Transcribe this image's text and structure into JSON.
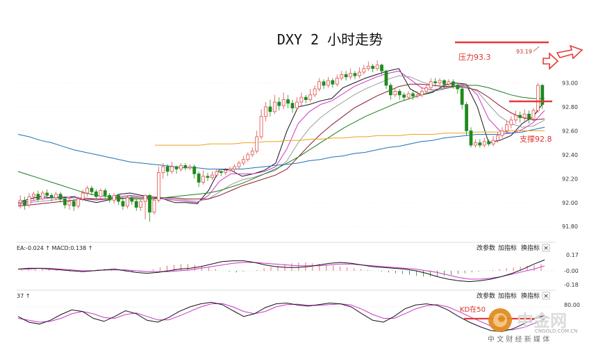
{
  "header": {
    "title": "DXY 2 小时走势"
  },
  "annotations": {
    "resistance_label": "压力93.3",
    "support_label": "支撑92.8",
    "current_high_label": "93.19",
    "kd_note": "KD在50"
  },
  "macd_panel": {
    "indicator_label": "EA:-0.024 ↑ MACD:0.138 ↑",
    "buttons": [
      "改参数",
      "加指标",
      "换指标",
      "×"
    ],
    "y_ticks": [
      "0.17",
      "-0.00",
      "-0.18"
    ]
  },
  "kd_panel": {
    "indicator_label": "37 ↑",
    "buttons": [
      "改参数",
      "加指标",
      "换指标",
      "×"
    ],
    "y_ticks": [
      "80.00"
    ]
  },
  "watermark": {
    "logo_text": "中金网",
    "domain": "CNGOLD.COM.CN",
    "tagline": "中 文 财 经 新 媒 体"
  },
  "chart_data": {
    "type": "line",
    "title": "DXY 2 小时走势",
    "y_ticks": [
      91.8,
      92.0,
      92.2,
      92.4,
      92.6,
      92.8,
      93.0
    ],
    "ylim": [
      91.72,
      93.2
    ],
    "levels": {
      "resistance": 93.3,
      "support": 92.8,
      "high": 93.19
    },
    "candles": [
      [
        92.0,
        92.02,
        92.06,
        91.95
      ],
      [
        92.02,
        91.98,
        92.05,
        91.94
      ],
      [
        91.98,
        92.05,
        92.08,
        91.96
      ],
      [
        92.05,
        92.07,
        92.09,
        92.02
      ],
      [
        92.07,
        92.03,
        92.1,
        92.01
      ],
      [
        92.03,
        92.08,
        92.1,
        92.02
      ],
      [
        92.08,
        92.06,
        92.11,
        92.04
      ],
      [
        92.06,
        92.04,
        92.08,
        92.01
      ],
      [
        92.04,
        92.07,
        92.09,
        92.02
      ],
      [
        92.07,
        92.03,
        92.09,
        92.0
      ],
      [
        92.03,
        91.98,
        92.05,
        91.95
      ],
      [
        91.98,
        92.01,
        92.04,
        91.94
      ],
      [
        92.01,
        91.97,
        92.03,
        91.93
      ],
      [
        91.97,
        92.03,
        92.05,
        91.95
      ],
      [
        92.03,
        92.08,
        92.11,
        92.01
      ],
      [
        92.08,
        92.12,
        92.14,
        92.05
      ],
      [
        92.12,
        92.09,
        92.14,
        92.06
      ],
      [
        92.09,
        92.05,
        92.11,
        92.03
      ],
      [
        92.05,
        92.1,
        92.12,
        92.03
      ],
      [
        92.1,
        92.06,
        92.12,
        92.03
      ],
      [
        92.06,
        92.02,
        92.08,
        92.0
      ],
      [
        92.02,
        92.06,
        92.08,
        91.99
      ],
      [
        92.06,
        92.01,
        92.07,
        91.98
      ],
      [
        92.01,
        91.97,
        92.04,
        91.94
      ],
      [
        91.97,
        92.04,
        92.06,
        91.95
      ],
      [
        92.04,
        92.01,
        92.06,
        91.98
      ],
      [
        92.01,
        91.96,
        92.03,
        91.93
      ],
      [
        91.96,
        92.01,
        92.03,
        91.93
      ],
      [
        92.01,
        92.06,
        92.07,
        91.86
      ],
      [
        92.06,
        91.92,
        92.07,
        91.84
      ],
      [
        91.92,
        92.02,
        92.05,
        91.9
      ],
      [
        92.02,
        92.25,
        92.3,
        92.0
      ],
      [
        92.25,
        92.3,
        92.33,
        92.2
      ],
      [
        92.3,
        92.26,
        92.32,
        92.22
      ],
      [
        92.26,
        92.3,
        92.34,
        92.24
      ],
      [
        92.3,
        92.28,
        92.31,
        92.24
      ],
      [
        92.28,
        92.31,
        92.33,
        92.26
      ],
      [
        92.31,
        92.29,
        92.33,
        92.27
      ],
      [
        92.29,
        92.3,
        92.32,
        92.27
      ],
      [
        92.3,
        92.24,
        92.32,
        92.2
      ],
      [
        92.24,
        92.17,
        92.26,
        92.13
      ],
      [
        92.17,
        92.22,
        92.27,
        92.15
      ],
      [
        92.22,
        92.21,
        92.25,
        92.18
      ],
      [
        92.21,
        92.23,
        92.26,
        92.19
      ],
      [
        92.23,
        92.26,
        92.28,
        92.21
      ],
      [
        92.26,
        92.25,
        92.28,
        92.22
      ],
      [
        92.25,
        92.27,
        92.29,
        92.23
      ],
      [
        92.27,
        92.28,
        92.3,
        92.25
      ],
      [
        92.28,
        92.3,
        92.32,
        92.26
      ],
      [
        92.3,
        92.33,
        92.35,
        92.28
      ],
      [
        92.33,
        92.36,
        92.39,
        92.31
      ],
      [
        92.36,
        92.4,
        92.42,
        92.34
      ],
      [
        92.4,
        92.43,
        92.46,
        92.38
      ],
      [
        92.43,
        92.55,
        92.6,
        92.41
      ],
      [
        92.55,
        92.72,
        92.78,
        92.53
      ],
      [
        92.72,
        92.8,
        92.84,
        92.68
      ],
      [
        92.8,
        92.76,
        92.86,
        92.72
      ],
      [
        92.76,
        92.84,
        92.9,
        92.74
      ],
      [
        92.84,
        92.81,
        92.88,
        92.77
      ],
      [
        92.81,
        92.86,
        92.92,
        92.78
      ],
      [
        92.86,
        92.83,
        92.9,
        92.79
      ],
      [
        92.83,
        92.79,
        92.86,
        92.75
      ],
      [
        92.79,
        92.84,
        92.88,
        92.77
      ],
      [
        92.84,
        92.88,
        92.92,
        92.81
      ],
      [
        92.88,
        92.86,
        92.9,
        92.83
      ],
      [
        92.86,
        92.9,
        92.95,
        92.84
      ],
      [
        92.9,
        92.95,
        92.98,
        92.88
      ],
      [
        92.95,
        93.01,
        93.04,
        92.93
      ],
      [
        93.01,
        92.98,
        93.03,
        92.95
      ],
      [
        92.98,
        93.02,
        93.05,
        92.96
      ],
      [
        93.02,
        92.99,
        93.04,
        92.96
      ],
      [
        92.99,
        93.04,
        93.07,
        92.97
      ],
      [
        93.04,
        93.07,
        93.1,
        93.02
      ],
      [
        93.07,
        93.05,
        93.1,
        93.02
      ],
      [
        93.05,
        93.08,
        93.12,
        93.03
      ],
      [
        93.08,
        93.06,
        93.1,
        93.03
      ],
      [
        93.06,
        93.09,
        93.13,
        93.04
      ],
      [
        93.09,
        93.12,
        93.15,
        93.07
      ],
      [
        93.12,
        93.14,
        93.18,
        93.1
      ],
      [
        93.14,
        93.12,
        93.16,
        93.09
      ],
      [
        93.12,
        93.15,
        93.19,
        93.1
      ],
      [
        93.15,
        93.1,
        93.16,
        93.07
      ],
      [
        93.1,
        92.98,
        93.11,
        92.95
      ],
      [
        92.98,
        92.9,
        93.0,
        92.86
      ],
      [
        92.9,
        92.93,
        92.96,
        92.88
      ],
      [
        92.93,
        92.9,
        92.95,
        92.86
      ],
      [
        92.9,
        92.88,
        92.92,
        92.85
      ],
      [
        92.88,
        92.91,
        92.93,
        92.86
      ],
      [
        92.91,
        92.89,
        92.93,
        92.86
      ],
      [
        92.89,
        92.9,
        92.93,
        92.87
      ],
      [
        92.9,
        92.93,
        92.96,
        92.88
      ],
      [
        92.93,
        92.96,
        92.99,
        92.91
      ],
      [
        92.96,
        93.01,
        93.04,
        92.94
      ],
      [
        93.01,
        93.0,
        93.04,
        92.97
      ],
      [
        93.0,
        93.02,
        93.04,
        92.98
      ],
      [
        93.02,
        92.99,
        93.03,
        92.96
      ],
      [
        92.99,
        93.01,
        93.03,
        92.97
      ],
      [
        93.01,
        92.98,
        93.03,
        92.95
      ],
      [
        92.98,
        92.95,
        93.0,
        92.91
      ],
      [
        92.95,
        92.82,
        92.96,
        92.78
      ],
      [
        92.82,
        92.6,
        92.84,
        92.56
      ],
      [
        92.6,
        92.48,
        92.63,
        92.46
      ],
      [
        92.48,
        92.5,
        92.53,
        92.46
      ],
      [
        92.5,
        92.48,
        92.53,
        92.46
      ],
      [
        92.48,
        92.51,
        92.54,
        92.46
      ],
      [
        92.51,
        92.49,
        92.53,
        92.47
      ],
      [
        92.49,
        92.52,
        92.56,
        92.47
      ],
      [
        92.52,
        92.56,
        92.59,
        92.5
      ],
      [
        92.56,
        92.6,
        92.63,
        92.54
      ],
      [
        92.6,
        92.65,
        92.68,
        92.58
      ],
      [
        92.65,
        92.69,
        92.72,
        92.62
      ],
      [
        92.69,
        92.73,
        92.77,
        92.66
      ],
      [
        92.73,
        92.71,
        92.76,
        92.67
      ],
      [
        92.71,
        92.74,
        92.78,
        92.68
      ],
      [
        92.74,
        92.7,
        92.77,
        92.66
      ],
      [
        92.7,
        92.77,
        92.79,
        92.68
      ],
      [
        92.77,
        92.98,
        93.0,
        92.75
      ],
      [
        92.98,
        92.82,
        92.99,
        92.78
      ]
    ],
    "moving_averages": [
      {
        "color": "#111111",
        "values": [
          92.0,
          92.03,
          92.05,
          92.04,
          92.04,
          92.05,
          92.02,
          92.0,
          92.02,
          92.07,
          92.08,
          92.06,
          92.05,
          92.03,
          92.0,
          92.0,
          91.99,
          92.1,
          92.28,
          92.27,
          92.22,
          92.24,
          92.27,
          92.33,
          92.6,
          92.8,
          92.82,
          92.85,
          92.87,
          92.96,
          93.0,
          93.04,
          93.07,
          93.1,
          93.12,
          92.95,
          92.9,
          92.92,
          92.98,
          93.0,
          92.99,
          92.8,
          92.5,
          92.52,
          92.56,
          92.66,
          92.72,
          92.85
        ]
      },
      {
        "color": "#cc33cc",
        "values": [
          91.99,
          92.01,
          92.03,
          92.04,
          92.05,
          92.04,
          92.03,
          92.02,
          92.03,
          92.05,
          92.06,
          92.05,
          92.04,
          92.03,
          92.02,
          92.01,
          92.0,
          92.06,
          92.18,
          92.24,
          92.24,
          92.24,
          92.26,
          92.3,
          92.45,
          92.66,
          92.76,
          92.82,
          92.85,
          92.91,
          92.97,
          93.01,
          93.05,
          93.08,
          93.1,
          93.03,
          92.96,
          92.94,
          92.96,
          92.98,
          92.99,
          92.9,
          92.7,
          92.6,
          92.58,
          92.61,
          92.67,
          92.77
        ]
      },
      {
        "color": "#9a9a9a",
        "values": [
          91.98,
          92.0,
          92.01,
          92.02,
          92.03,
          92.04,
          92.04,
          92.03,
          92.03,
          92.04,
          92.05,
          92.05,
          92.05,
          92.04,
          92.03,
          92.02,
          92.01,
          92.03,
          92.09,
          92.15,
          92.19,
          92.21,
          92.24,
          92.27,
          92.35,
          92.5,
          92.62,
          92.71,
          92.78,
          92.84,
          92.9,
          92.95,
          92.99,
          93.03,
          93.06,
          93.05,
          93.01,
          92.98,
          92.97,
          92.97,
          92.97,
          92.93,
          92.82,
          92.72,
          92.66,
          92.63,
          92.64,
          92.69
        ]
      },
      {
        "color": "#8b1a2e",
        "values": [
          91.97,
          91.98,
          91.99,
          92.0,
          92.01,
          92.02,
          92.03,
          92.03,
          92.03,
          92.03,
          92.04,
          92.04,
          92.04,
          92.04,
          92.04,
          92.03,
          92.03,
          92.03,
          92.06,
          92.1,
          92.14,
          92.17,
          92.2,
          92.23,
          92.28,
          92.38,
          92.48,
          92.57,
          92.65,
          92.72,
          92.79,
          92.84,
          92.89,
          92.93,
          92.97,
          92.99,
          92.99,
          92.98,
          92.97,
          92.97,
          92.96,
          92.94,
          92.88,
          92.81,
          92.75,
          92.71,
          92.69,
          92.7
        ]
      },
      {
        "color": "#1d7a1d",
        "values": [
          92.26,
          92.23,
          92.2,
          92.17,
          92.14,
          92.11,
          92.08,
          92.06,
          92.05,
          92.04,
          92.03,
          92.03,
          92.03,
          92.04,
          92.05,
          92.06,
          92.07,
          92.08,
          92.1,
          92.13,
          92.16,
          92.2,
          92.24,
          92.28,
          92.33,
          92.38,
          92.44,
          92.5,
          92.56,
          92.62,
          92.67,
          92.72,
          92.76,
          92.8,
          92.84,
          92.87,
          92.9,
          92.93,
          92.95,
          92.97,
          92.98,
          92.98,
          92.96,
          92.93,
          92.9,
          92.88,
          92.87,
          92.87
        ]
      },
      {
        "color": "#1b6fb5",
        "values": [
          92.57,
          92.55,
          92.52,
          92.5,
          92.47,
          92.44,
          92.42,
          92.4,
          92.38,
          92.36,
          92.34,
          92.33,
          92.32,
          92.31,
          92.3,
          92.29,
          92.29,
          92.28,
          92.28,
          92.28,
          92.28,
          92.29,
          92.3,
          92.31,
          92.32,
          92.33,
          92.35,
          92.36,
          92.38,
          92.39,
          92.41,
          92.42,
          92.44,
          92.46,
          92.47,
          92.49,
          92.51,
          92.52,
          92.54,
          92.55,
          92.56,
          92.57,
          92.57,
          92.57,
          92.58,
          92.59,
          92.61,
          92.63
        ]
      },
      {
        "color": "#e8a317",
        "start": 0.26,
        "values": [
          92.48,
          92.48,
          92.48,
          92.48,
          92.48,
          92.49,
          92.49,
          92.49,
          92.5,
          92.5,
          92.51,
          92.51,
          92.52,
          92.52,
          92.53,
          92.53,
          92.54,
          92.54,
          92.55,
          92.55,
          92.56,
          92.56,
          92.56,
          92.57,
          92.57,
          92.57,
          92.58,
          92.58,
          92.58,
          92.59,
          92.59,
          92.59,
          92.6,
          92.6,
          92.6,
          92.6
        ]
      }
    ],
    "macd_hist": [
      0.01,
      0.02,
      0.02,
      0.03,
      0.02,
      0.01,
      0.0,
      -0.01,
      -0.01,
      0.0,
      0.01,
      0.02,
      0.02,
      0.01,
      0.0,
      -0.01,
      -0.02,
      -0.01,
      0.0,
      0.02,
      0.04,
      0.06,
      0.07,
      0.08,
      0.08,
      0.07,
      0.06,
      0.04,
      0.02,
      0.0,
      -0.01,
      -0.02,
      -0.01,
      0.0,
      0.01,
      0.03,
      0.05,
      0.06,
      0.08,
      0.09,
      0.1,
      0.1,
      0.09,
      0.08,
      0.07,
      0.06,
      0.05,
      0.04,
      0.03,
      0.02,
      0.01,
      0.0,
      -0.01,
      -0.02,
      -0.03,
      -0.04,
      -0.05,
      -0.06,
      -0.07,
      -0.07,
      -0.07,
      -0.06,
      -0.05,
      -0.04,
      -0.03,
      -0.02,
      -0.01,
      0.0,
      0.01,
      0.02,
      0.03,
      0.04,
      0.05,
      0.06,
      0.07,
      0.08
    ],
    "macd_diff": [
      0.02,
      0.03,
      0.03,
      0.02,
      0.01,
      0.0,
      -0.01,
      0.0,
      0.01,
      0.02,
      0.0,
      -0.02,
      -0.03,
      -0.02,
      0.0,
      0.02,
      0.03,
      0.05,
      0.08,
      0.11,
      0.12,
      0.12,
      0.1,
      0.07,
      0.05,
      0.04,
      0.04,
      0.05,
      0.07,
      0.09,
      0.1,
      0.09,
      0.07,
      0.05,
      0.04,
      0.03,
      0.02,
      0.0,
      -0.03,
      -0.07,
      -0.1,
      -0.12,
      -0.13,
      -0.12,
      -0.1,
      -0.07,
      -0.03,
      0.02,
      0.08,
      0.13
    ],
    "macd_dea": [
      0.02,
      0.02,
      0.03,
      0.03,
      0.02,
      0.01,
      0.0,
      0.0,
      0.01,
      0.01,
      0.01,
      0.0,
      -0.01,
      -0.01,
      -0.01,
      0.0,
      0.01,
      0.03,
      0.05,
      0.07,
      0.09,
      0.1,
      0.1,
      0.09,
      0.08,
      0.07,
      0.06,
      0.06,
      0.06,
      0.07,
      0.08,
      0.08,
      0.07,
      0.06,
      0.05,
      0.04,
      0.03,
      0.02,
      0.0,
      -0.02,
      -0.05,
      -0.08,
      -0.1,
      -0.1,
      -0.09,
      -0.07,
      -0.04,
      -0.01,
      0.02,
      0.06
    ],
    "kd_k": [
      55,
      40,
      35,
      45,
      60,
      72,
      68,
      50,
      42,
      55,
      70,
      62,
      45,
      40,
      52,
      68,
      80,
      88,
      92,
      86,
      70,
      55,
      62,
      78,
      88,
      90,
      85,
      82,
      86,
      90,
      88,
      80,
      62,
      45,
      40,
      55,
      75,
      85,
      88,
      84,
      72,
      55,
      40,
      28,
      18,
      15,
      22,
      35,
      48,
      58
    ],
    "kd_d": [
      50,
      45,
      40,
      42,
      50,
      62,
      68,
      62,
      52,
      50,
      60,
      64,
      55,
      46,
      46,
      56,
      68,
      80,
      88,
      89,
      80,
      68,
      62,
      68,
      80,
      86,
      87,
      84,
      84,
      86,
      88,
      85,
      74,
      60,
      50,
      50,
      62,
      75,
      83,
      86,
      80,
      68,
      55,
      42,
      30,
      22,
      20,
      26,
      36,
      48
    ]
  }
}
